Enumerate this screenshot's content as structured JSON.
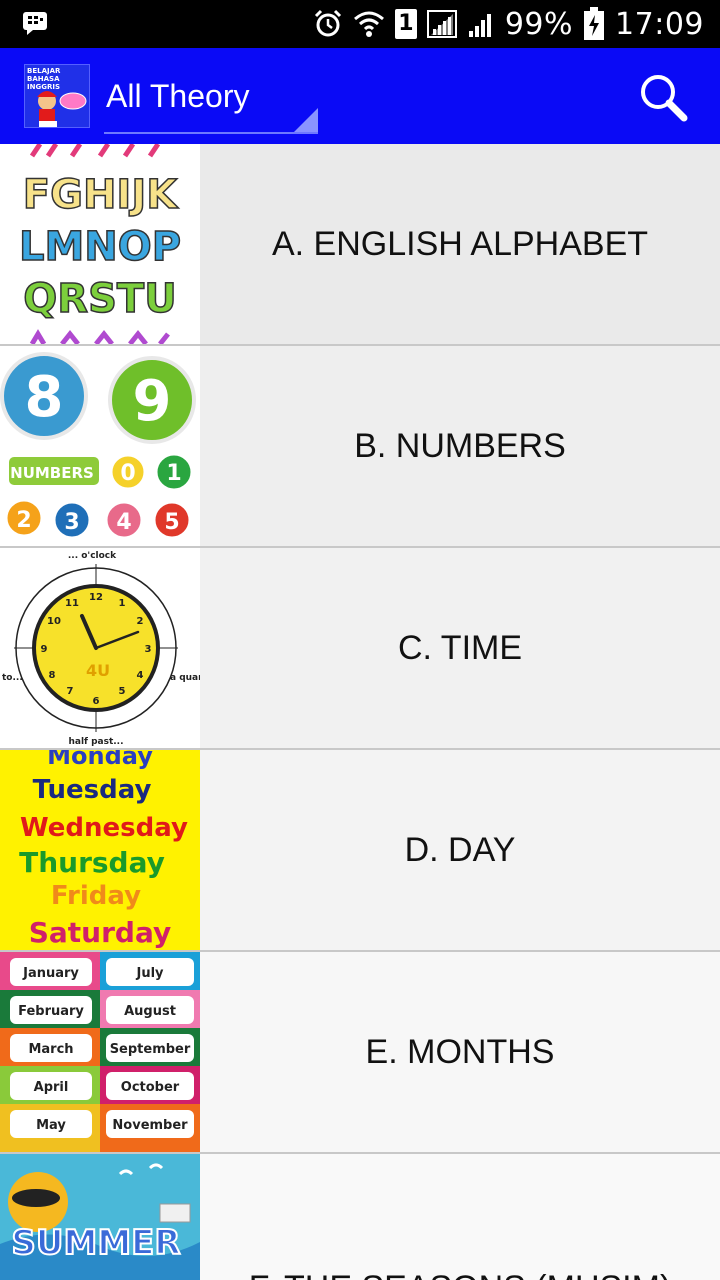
{
  "status_bar": {
    "battery": "99%",
    "time": "17:09",
    "sim_badge": "1"
  },
  "app_bar": {
    "logo_text": "BELAJAR BAHASA INGGRIS",
    "spinner_value": "All Theory"
  },
  "list": {
    "items": [
      {
        "label": "A. ENGLISH ALPHABET",
        "thumb": "alphabet-thumbnail"
      },
      {
        "label": "B. NUMBERS",
        "thumb": "numbers-thumbnail"
      },
      {
        "label": "C. TIME",
        "thumb": "clock-thumbnail"
      },
      {
        "label": "D. DAY",
        "thumb": "days-thumbnail"
      },
      {
        "label": "E. MONTHS",
        "thumb": "months-thumbnail"
      },
      {
        "label": "F. THE SEASONS (MUSIM)",
        "thumb": "summer-thumbnail"
      }
    ]
  },
  "thumbnails": {
    "alphabet": {
      "line1": "FGHIJK",
      "line2": "LMNOP",
      "line3": "QRSTU"
    },
    "numbers": {
      "n8": "8",
      "n9": "9",
      "tag": "NUMBERS",
      "n0": "0",
      "n1": "1",
      "n2": "2",
      "n3": "3",
      "n4": "4",
      "n5": "5"
    },
    "clock": {
      "top": "... o'clock",
      "bottom": "half past...",
      "left": "to...",
      "right": "a quar",
      "h12": "12",
      "h1": "1",
      "h2": "2",
      "h3": "3",
      "h4": "4",
      "h5": "5",
      "h6": "6",
      "h7": "7",
      "h8": "8",
      "h9": "9",
      "h10": "10",
      "h11": "11",
      "center": "4U"
    },
    "days": {
      "d1": "Monday",
      "d2": "Tuesday",
      "d3": "Wednesday",
      "d4": "Thursday",
      "d5": "Friday",
      "d6": "Saturday"
    },
    "months": {
      "m1": "January",
      "m2": "February",
      "m3": "March",
      "m4": "April",
      "m5": "May",
      "m7": "July",
      "m8": "August",
      "m9": "September",
      "m10": "October",
      "m11": "November"
    },
    "summer": {
      "word": "SUMMER"
    }
  },
  "colors": {
    "app_bar": "#0a0af6",
    "status_bar": "#000000",
    "days_bg": "#fff200"
  }
}
